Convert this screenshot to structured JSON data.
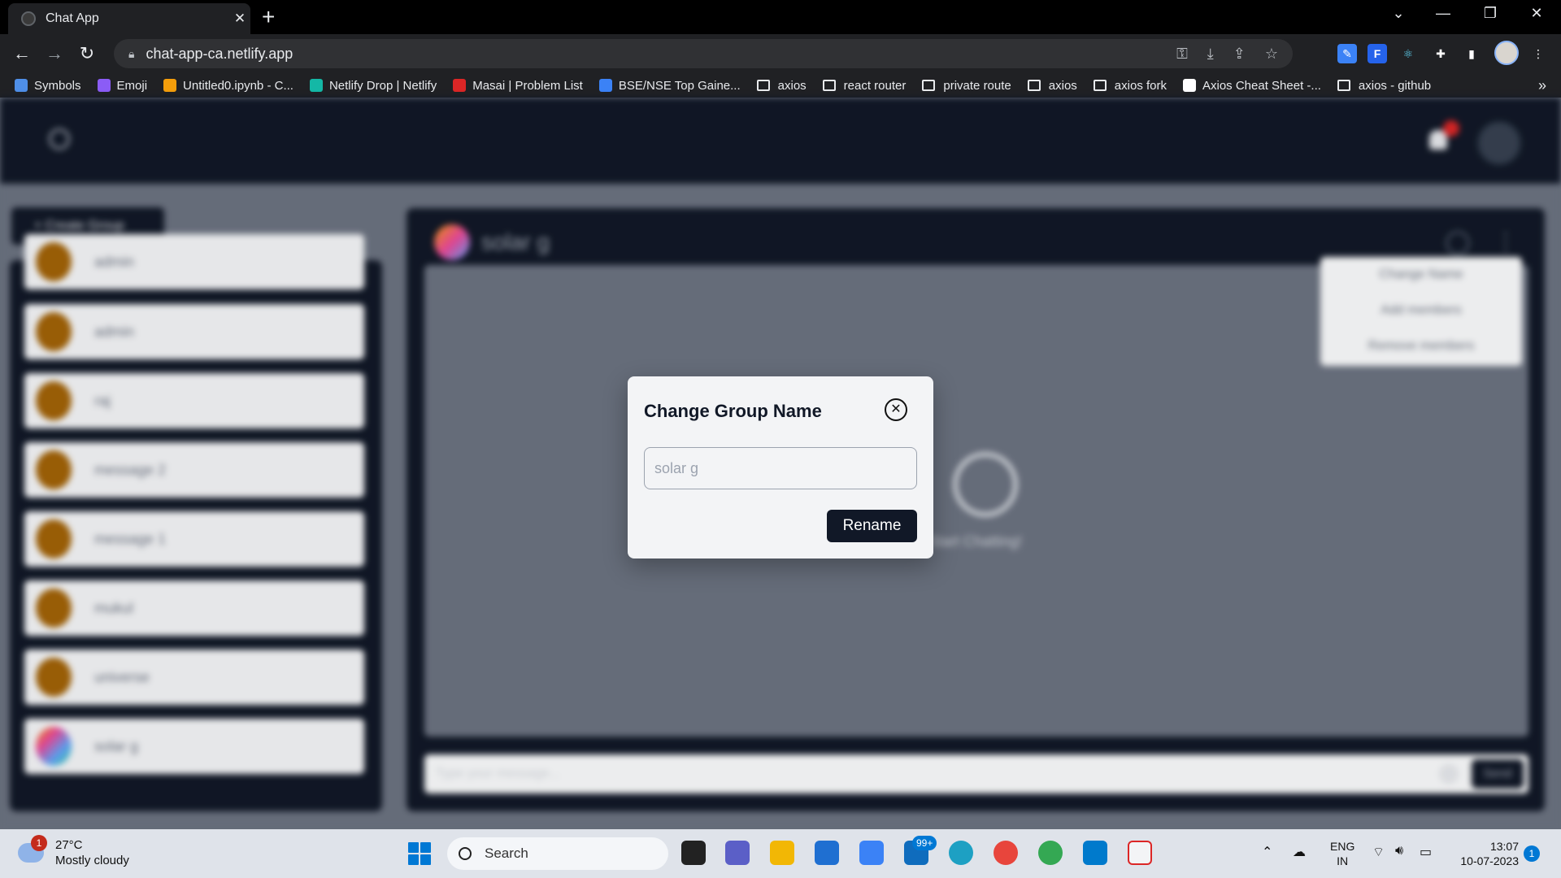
{
  "browser": {
    "tab_title": "Chat App",
    "tab_close": "✕",
    "new_tab": "+",
    "url": "chat-app-ca.netlify.app",
    "bookmarks": [
      {
        "label": "Symbols",
        "icon": "symbols-icon",
        "color": "#4f8fe8"
      },
      {
        "label": "Emoji",
        "icon": "emoji-icon",
        "color": "#8b5cf6"
      },
      {
        "label": "Untitled0.ipynb - C...",
        "icon": "colab-icon",
        "color": "#f59e0b"
      },
      {
        "label": "Netlify Drop | Netlify",
        "icon": "netlify-icon",
        "color": "#14b8a6"
      },
      {
        "label": "Masai | Problem List",
        "icon": "masai-icon",
        "color": "#dc2626"
      },
      {
        "label": "BSE/NSE Top Gaine...",
        "icon": "bse-icon",
        "color": "#3b82f6"
      },
      {
        "label": "axios",
        "icon": "folder-icon"
      },
      {
        "label": "react router",
        "icon": "folder-icon"
      },
      {
        "label": "private route",
        "icon": "folder-icon"
      },
      {
        "label": "axios",
        "icon": "folder-icon"
      },
      {
        "label": "axios fork",
        "icon": "folder-icon"
      },
      {
        "label": "Axios Cheat Sheet -...",
        "icon": "k-icon",
        "color": "#ffffff"
      },
      {
        "label": "axios - github",
        "icon": "folder-icon"
      }
    ],
    "more_bookmarks": "»"
  },
  "app": {
    "create_group_label": "+   Create Group",
    "chats": [
      {
        "name": "admin",
        "avatar": "avatar-person"
      },
      {
        "name": "admin",
        "avatar": "avatar-person"
      },
      {
        "name": "raj",
        "avatar": "avatar-person"
      },
      {
        "name": "message 2",
        "avatar": "avatar-person"
      },
      {
        "name": "message 1",
        "avatar": "avatar-person"
      },
      {
        "name": "mukul",
        "avatar": "avatar-person"
      },
      {
        "name": "universe",
        "avatar": "avatar-person"
      },
      {
        "name": "solar g",
        "avatar": "avatar-group"
      }
    ],
    "chat_title": "solar g",
    "empty_text": "Start Chatting!",
    "message_placeholder": "Type your message...",
    "send_label": "Send",
    "menu": [
      "Change Name",
      "Add members",
      "Remove members"
    ]
  },
  "modal": {
    "title": "Change Group Name",
    "close_glyph": "✕",
    "input_placeholder": "solar g",
    "input_value": "",
    "button_label": "Rename"
  },
  "taskbar": {
    "weather_badge": "1",
    "temperature": "27°C",
    "condition": "Mostly cloudy",
    "search_label": "Search",
    "outlook_badge": "99+",
    "lang_line1": "ENG",
    "lang_line2": "IN",
    "time": "13:07",
    "date": "10-07-2023",
    "notification_count": "1"
  }
}
